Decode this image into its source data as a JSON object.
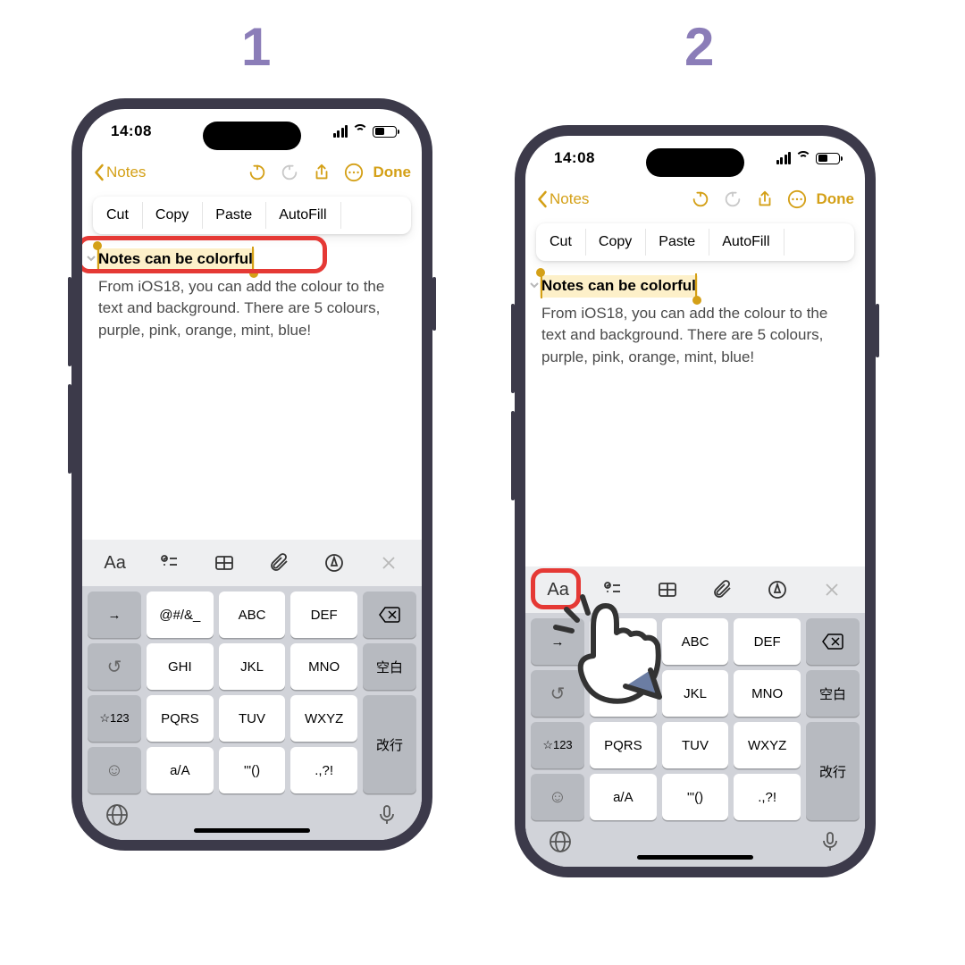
{
  "steps": {
    "s1": "1",
    "s2": "2"
  },
  "status": {
    "time": "14:08"
  },
  "nav": {
    "back": "Notes",
    "done": "Done"
  },
  "context_menu": {
    "cut": "Cut",
    "copy": "Copy",
    "paste": "Paste",
    "autofill": "AutoFill"
  },
  "note": {
    "title": "Notes can be colorful",
    "body": "From iOS18, you can add the colour to the text and background. There are 5 colours, purple, pink, orange, mint, blue!"
  },
  "format_bar": {
    "aa": "Aa"
  },
  "keyboard": {
    "r1": [
      "@#/&_",
      "ABC",
      "DEF"
    ],
    "r2": [
      "GHI",
      "JKL",
      "MNO"
    ],
    "r3": [
      "PQRS",
      "TUV",
      "WXYZ"
    ],
    "r4": [
      "a/A",
      "'\"()",
      ".,?!"
    ],
    "left": {
      "arrow": "→",
      "undo": "↺",
      "star": "☆123",
      "smile": "☺"
    },
    "right": {
      "space": "空白",
      "enter": "改行"
    }
  }
}
